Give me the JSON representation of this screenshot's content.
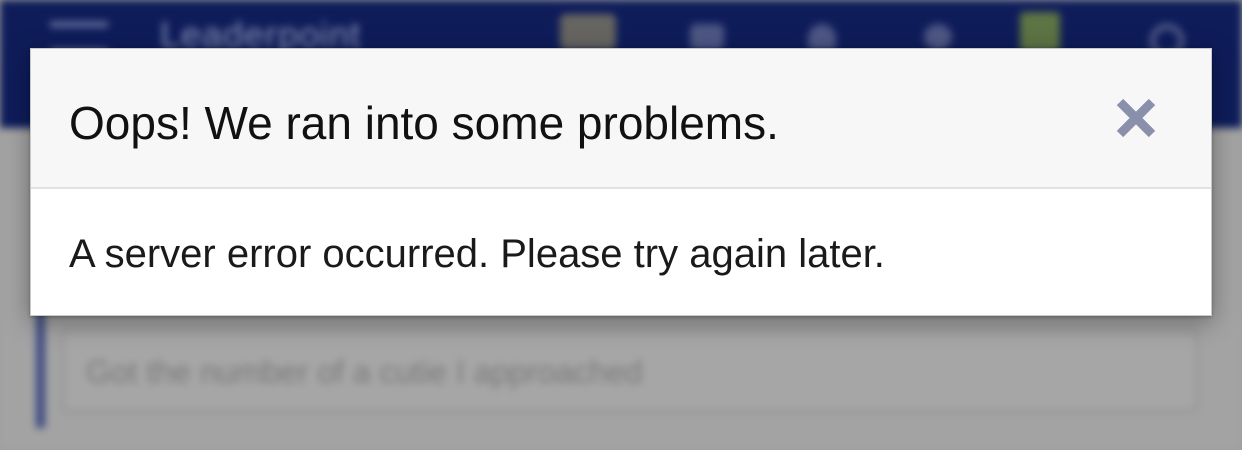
{
  "background_app": {
    "title": "Leaderpoint",
    "input_text": "Got the number of a cutie I approached"
  },
  "dialog": {
    "title": "Oops! We ran into some problems.",
    "message": "A server error occurred. Please try again later.",
    "close_icon": "close-icon"
  },
  "colors": {
    "topbar": "#0e1c5a",
    "close_icon": "#8a90ab",
    "title_text": "#111111",
    "header_bg": "#f7f7f7"
  }
}
